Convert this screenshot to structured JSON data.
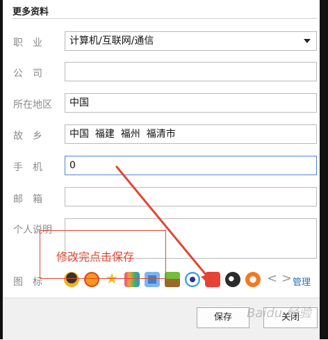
{
  "section": {
    "title": "更多资料"
  },
  "fields": {
    "occupation": {
      "label": "职　业",
      "value": "计算机/互联网/通信"
    },
    "company": {
      "label": "公　司",
      "value": ""
    },
    "region": {
      "label": "所在地区",
      "value": "中国"
    },
    "hometown": {
      "label": "故　乡",
      "value": "中国  福建  福州  福清市"
    },
    "phone": {
      "label": "手　机",
      "value": "0"
    },
    "email": {
      "label": "邮　箱",
      "value": ""
    },
    "bio": {
      "label": "个人说明",
      "value": ""
    },
    "icons": {
      "label": "图　标"
    }
  },
  "icons": [
    "qq-penguin-icon",
    "gift-icon",
    "star-icon",
    "vip-icon",
    "camera-icon",
    "game-icon",
    "eye-icon",
    "lightning-icon",
    "cow-icon",
    "g-badge-icon"
  ],
  "nav": {
    "prev": "<",
    "next": ">",
    "manage": "管理"
  },
  "buttons": {
    "save": "保存",
    "close": "关闭"
  },
  "annotation": {
    "text": "修改完点击保存"
  },
  "watermark": {
    "text": "Baidu 经验"
  },
  "colors": {
    "annotation": "#e3442f",
    "link": "#2a6fb8",
    "focus": "#4b86d8"
  }
}
